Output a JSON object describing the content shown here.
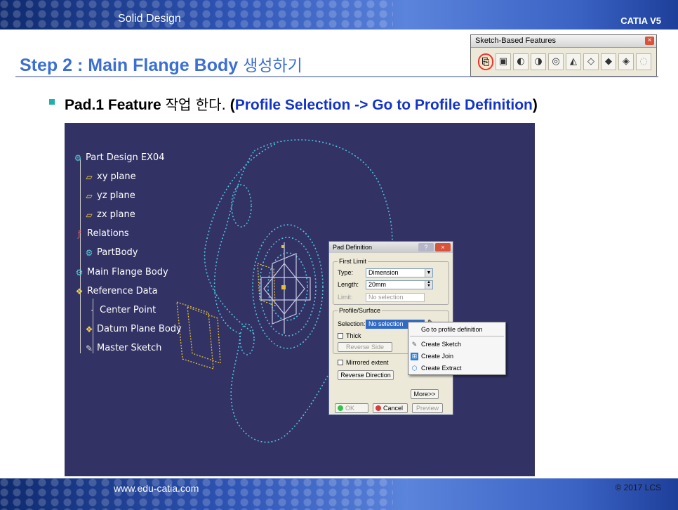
{
  "header": {
    "section": "Solid Design",
    "brand": "CATIA V5"
  },
  "title": {
    "text": "Step 2 : Main Flange Body",
    "korean": "생성하기"
  },
  "toolbar": {
    "title": "Sketch-Based Features",
    "close_label": "×",
    "icons": [
      "pad-icon",
      "pocket-icon",
      "shaft-icon",
      "groove-icon",
      "hole-icon",
      "rib-icon",
      "slot-icon",
      "stiffener-icon",
      "multi-sections-solid-icon",
      "removed-multi-sections-icon"
    ]
  },
  "bullet": {
    "lead": "Pad.1 Feature",
    "korean": "작업 한다.",
    "paren_open": " (",
    "highlight": "Profile Selection -> Go to Profile Definition",
    "paren_close": ")"
  },
  "tree": {
    "root": "Part Design EX04",
    "items": [
      {
        "label": "xy plane"
      },
      {
        "label": "yz plane"
      },
      {
        "label": "zx plane"
      },
      {
        "label": "Relations"
      },
      {
        "label": "PartBody"
      },
      {
        "label": "Main Flange Body"
      },
      {
        "label": "Reference Data"
      },
      {
        "label": "Center Point"
      },
      {
        "label": "Datum Plane Body"
      },
      {
        "label": "Master Sketch"
      }
    ]
  },
  "dialog": {
    "title": "Pad Definition",
    "help_label": "?",
    "close_label": "×",
    "first_limit": {
      "label": "First Limit",
      "type_label": "Type:",
      "type_value": "Dimension",
      "length_label": "Length:",
      "length_value": "20mm",
      "limit_label": "Limit:",
      "limit_value": "No selection"
    },
    "profile": {
      "label": "Profile/Surface",
      "selection_label": "Selection:",
      "selection_value": "No selection",
      "thick_label": "Thick",
      "reverse_side_label": "Reverse Side"
    },
    "mirrored_label": "Mirrored extent",
    "reverse_direction_label": "Reverse Direction",
    "more_label": "More>>",
    "ok_label": "OK",
    "cancel_label": "Cancel",
    "preview_label": "Preview"
  },
  "context_menu": {
    "items": [
      "Go to profile definition",
      "Create Sketch",
      "Create Join",
      "Create Extract"
    ]
  },
  "footer": {
    "url": "www.edu-catia.com",
    "copyright": "© 2017 LCS"
  },
  "colors": {
    "title_blue": "#3b6fd6",
    "highlight_blue": "#1434c8",
    "screen_bg": "#323264",
    "wireframe": "#4fc3e0",
    "datum_yellow": "#e3c233"
  }
}
